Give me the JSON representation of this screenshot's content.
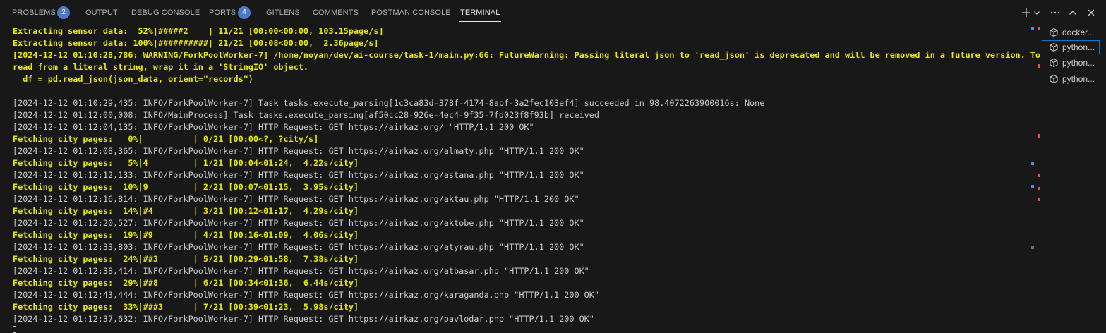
{
  "tabs": [
    {
      "label": "PROBLEMS",
      "badge": "2"
    },
    {
      "label": "OUTPUT"
    },
    {
      "label": "DEBUG CONSOLE"
    },
    {
      "label": "PORTS",
      "badge": "4"
    },
    {
      "label": "GITLENS"
    },
    {
      "label": "COMMENTS"
    },
    {
      "label": "POSTMAN CONSOLE"
    },
    {
      "label": "TERMINAL"
    }
  ],
  "actions": [
    "plus-icon",
    "chevron-down-icon",
    "more-icon",
    "maximize-panel-icon",
    "close-icon"
  ],
  "colors": {
    "background": "#181818",
    "text": "#cccccc",
    "warning_yellow": "#e5e510",
    "accent_blue": "#0078d4",
    "badge_blue": "#4d78cc",
    "marker_red": "#f14c4c",
    "marker_blue": "#3794ff"
  },
  "terminal": {
    "lines": [
      {
        "kind": "bar",
        "text": "Extracting sensor data:  52%|#####2    | 11/21 [00:00<00:00, 103.15page/s]"
      },
      {
        "kind": "bar",
        "text": "Extracting sensor data: 100%|##########| 21/21 [00:08<00:00,  2.36page/s]"
      },
      {
        "kind": "warn",
        "text": "[2024-12-12 01:10:28,786: WARNING/ForkPoolWorker-7] /home/noyan/dev/ai-course/task-1/main.py:66: FutureWarning: Passing literal json to 'read_json' is deprecated and will be removed in a future version. To"
      },
      {
        "kind": "warn",
        "text": "read from a literal string, wrap it in a 'StringIO' object."
      },
      {
        "kind": "warn",
        "text": "  df = pd.read_json(json_data, orient=\"records\")"
      },
      {
        "kind": "normal",
        "text": ""
      },
      {
        "kind": "normal",
        "text": "[2024-12-12 01:10:29,435: INFO/ForkPoolWorker-7] Task tasks.execute_parsing[1c3ca83d-378f-4174-8abf-3a2fec103ef4] succeeded in 98.4072263900016s: None"
      },
      {
        "kind": "normal",
        "text": "[2024-12-12 01:12:00,008: INFO/MainProcess] Task tasks.execute_parsing[af50cc28-926e-4ec4-9f35-7fd023f8f93b] received"
      },
      {
        "kind": "normal",
        "text": "[2024-12-12 01:12:04,135: INFO/ForkPoolWorker-7] HTTP Request: GET https://airkaz.org/ \"HTTP/1.1 200 OK\""
      },
      {
        "kind": "bar",
        "text": "Fetching city pages:   0%|          | 0/21 [00:00<?, ?city/s]"
      },
      {
        "kind": "normal",
        "text": "[2024-12-12 01:12:08,365: INFO/ForkPoolWorker-7] HTTP Request: GET https://airkaz.org/almaty.php \"HTTP/1.1 200 OK\""
      },
      {
        "kind": "bar",
        "text": "Fetching city pages:   5%|4         | 1/21 [00:04<01:24,  4.22s/city]"
      },
      {
        "kind": "normal",
        "text": "[2024-12-12 01:12:12,133: INFO/ForkPoolWorker-7] HTTP Request: GET https://airkaz.org/astana.php \"HTTP/1.1 200 OK\""
      },
      {
        "kind": "bar",
        "text": "Fetching city pages:  10%|9         | 2/21 [00:07<01:15,  3.95s/city]"
      },
      {
        "kind": "normal",
        "text": "[2024-12-12 01:12:16,814: INFO/ForkPoolWorker-7] HTTP Request: GET https://airkaz.org/aktau.php \"HTTP/1.1 200 OK\""
      },
      {
        "kind": "bar",
        "text": "Fetching city pages:  14%|#4        | 3/21 [00:12<01:17,  4.29s/city]"
      },
      {
        "kind": "normal",
        "text": "[2024-12-12 01:12:20,527: INFO/ForkPoolWorker-7] HTTP Request: GET https://airkaz.org/aktobe.php \"HTTP/1.1 200 OK\""
      },
      {
        "kind": "bar",
        "text": "Fetching city pages:  19%|#9        | 4/21 [00:16<01:09,  4.06s/city]"
      },
      {
        "kind": "normal",
        "text": "[2024-12-12 01:12:33,803: INFO/ForkPoolWorker-7] HTTP Request: GET https://airkaz.org/atyrau.php \"HTTP/1.1 200 OK\""
      },
      {
        "kind": "bar",
        "text": "Fetching city pages:  24%|##3       | 5/21 [00:29<01:58,  7.38s/city]"
      },
      {
        "kind": "normal",
        "text": "[2024-12-12 01:12:38,414: INFO/ForkPoolWorker-7] HTTP Request: GET https://airkaz.org/atbasar.php \"HTTP/1.1 200 OK\""
      },
      {
        "kind": "bar",
        "text": "Fetching city pages:  29%|##8       | 6/21 [00:34<01:36,  6.44s/city]"
      },
      {
        "kind": "normal",
        "text": "[2024-12-12 01:12:43,444: INFO/ForkPoolWorker-7] HTTP Request: GET https://airkaz.org/karaganda.php \"HTTP/1.1 200 OK\""
      },
      {
        "kind": "bar",
        "text": "Fetching city pages:  33%|###3      | 7/21 [00:39<01:23,  5.98s/city]"
      },
      {
        "kind": "normal",
        "text": "[2024-12-12 01:12:37,632: INFO/ForkPoolWorker-7] HTTP Request: GET https://airkaz.org/pavlodar.php \"HTTP/1.1 200 OK\""
      }
    ]
  },
  "terminal_list": [
    {
      "label": "docker..."
    },
    {
      "label": "python..."
    },
    {
      "label": "python..."
    },
    {
      "label": "python..."
    }
  ]
}
